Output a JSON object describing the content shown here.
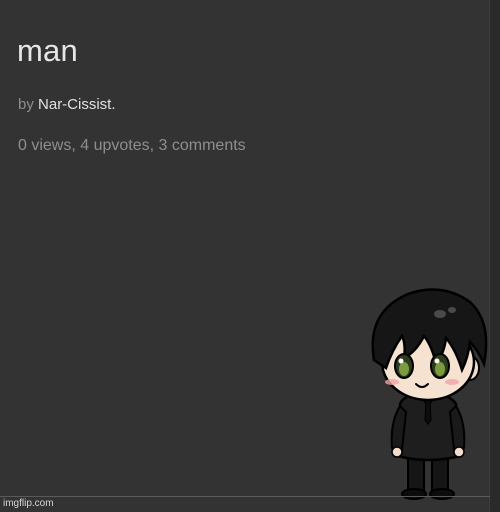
{
  "post": {
    "title": "man",
    "by_prefix": "by",
    "author": "Nar-Cissist.",
    "stats": "0 views, 4 upvotes, 3 comments"
  },
  "watermark": "imgflip.com",
  "colors": {
    "background": "#333333",
    "title": "#e6e6e6",
    "meta": "#8e8e8e",
    "author": "#e0e0e0"
  },
  "image": {
    "subject": "chibi-character-icon"
  }
}
